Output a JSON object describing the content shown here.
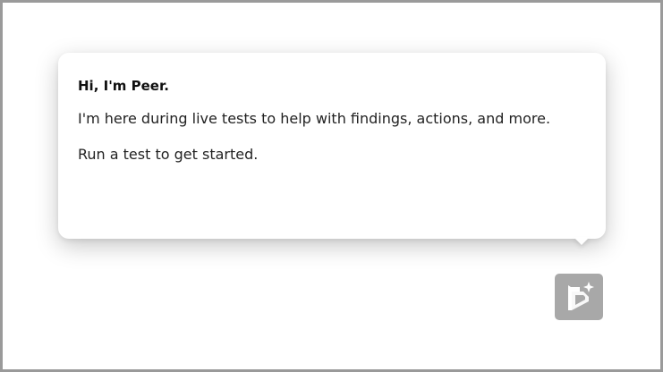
{
  "popover": {
    "title": "Hi, I'm Peer.",
    "description": "I'm here during live tests to help with findings, actions, and more.",
    "cta": "Run a test to get started."
  },
  "assistant_button": {
    "icon": "peer-sparkle-icon",
    "color": "#a8a8a8"
  },
  "colors": {
    "frame_border": "#9a9a9a",
    "popover_background": "#ffffff",
    "text": "#222222"
  }
}
